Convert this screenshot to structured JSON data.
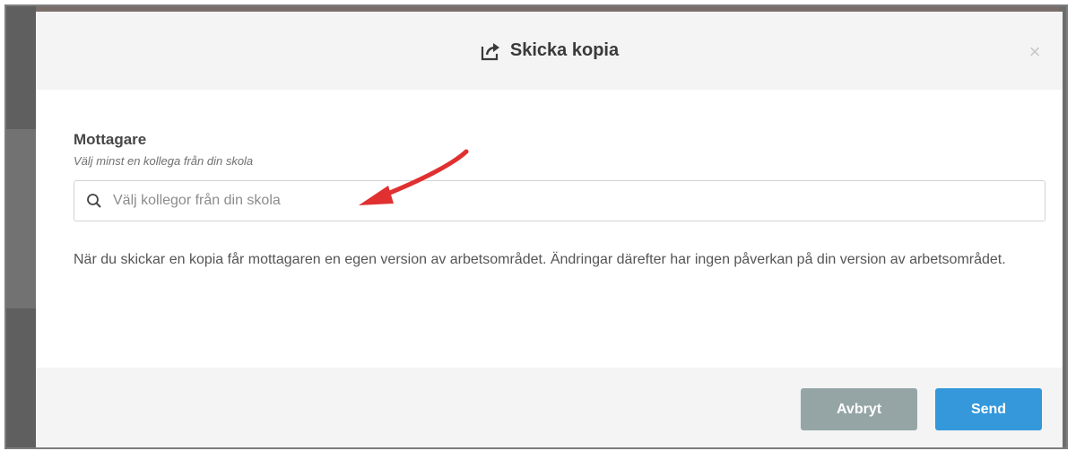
{
  "dialog": {
    "title": "Skicka kopia",
    "title_icon": "share-icon",
    "close_icon": "close-icon",
    "close_glyph": "×"
  },
  "recipient": {
    "label": "Mottagare",
    "hint": "Välj minst en kollega från din skola",
    "search_icon": "search-icon",
    "placeholder": "Välj kollegor från din skola",
    "value": ""
  },
  "description": "När du skickar en kopia får mottagaren en egen version av arbetsområdet. Ändringar därefter har ingen påverkan på din version av arbetsområdet.",
  "footer": {
    "cancel_label": "Avbryt",
    "send_label": "Send"
  },
  "colors": {
    "send_button": "#3498db",
    "cancel_button": "#95a5a6",
    "annotation_arrow": "#e03030"
  }
}
